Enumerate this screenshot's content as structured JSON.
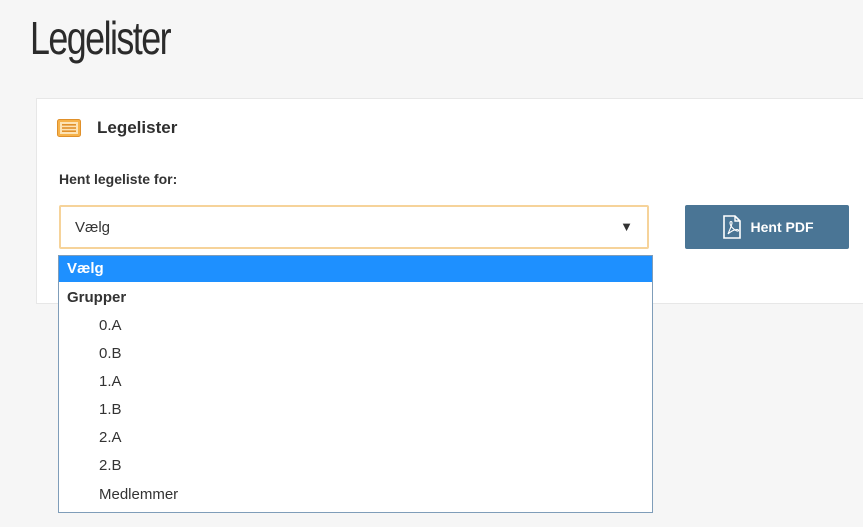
{
  "page": {
    "title": "Legelister"
  },
  "panel": {
    "title": "Legelister",
    "icon": "list-icon",
    "field_label": "Hent legeliste for:"
  },
  "select": {
    "value": "Vælg",
    "arrow": "▼"
  },
  "button": {
    "label": "Hent PDF",
    "icon": "pdf-icon"
  },
  "dropdown": {
    "options": [
      {
        "label": "Vælg",
        "kind": "option",
        "selected": true
      },
      {
        "label": "Grupper",
        "kind": "group"
      },
      {
        "label": "0.A",
        "kind": "child"
      },
      {
        "label": "0.B",
        "kind": "child"
      },
      {
        "label": "1.A",
        "kind": "child"
      },
      {
        "label": "1.B",
        "kind": "child"
      },
      {
        "label": "2.A",
        "kind": "child"
      },
      {
        "label": "2.B",
        "kind": "child"
      },
      {
        "label": "Medlemmer",
        "kind": "child"
      }
    ]
  },
  "colors": {
    "button_bg": "#4a7595",
    "select_border": "#f6d39a",
    "selected_bg": "#1e90ff",
    "icon_accent": "#f0a030"
  }
}
